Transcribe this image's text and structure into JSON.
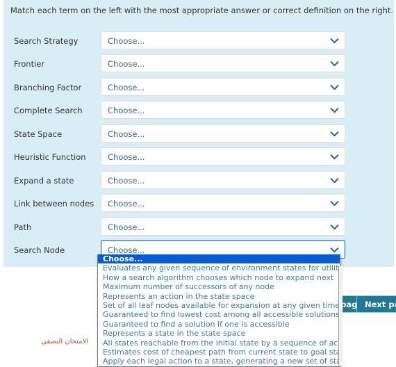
{
  "question": {
    "prompt": "Match each term on the left with the most appropriate answer or correct definition on the right.",
    "rows": [
      {
        "term": "Search Strategy",
        "value": "Choose..."
      },
      {
        "term": "Frontier",
        "value": "Choose..."
      },
      {
        "term": "Branching Factor",
        "value": "Choose..."
      },
      {
        "term": "Complete Search",
        "value": "Choose..."
      },
      {
        "term": "State Space",
        "value": "Choose..."
      },
      {
        "term": "Heuristic Function",
        "value": "Choose..."
      },
      {
        "term": "Expand a state",
        "value": "Choose..."
      },
      {
        "term": "Link between nodes",
        "value": "Choose..."
      },
      {
        "term": "Path",
        "value": "Choose..."
      },
      {
        "term": "Search Node",
        "value": "Choose..."
      }
    ]
  },
  "dropdown": {
    "open_for_row": "Search Node",
    "options": [
      "Choose...",
      "Evaluates any given sequence of environment states for utility",
      "How a search algorithm chooses which node to expand next",
      "Maximum number of successors of any node",
      "Represents an action in the state space",
      "Set of all leaf nodes available for expansion at any given time",
      "Guaranteed to find lowest cost among all accessible solutions",
      "Guaranteed to find a solution if one is accessible",
      "Represents a state in the state space",
      "All states reachable from the initial state by a sequence of actions",
      "Estimates cost of cheapest path from current state to goal state",
      "Apply each legal action to a state, generating a new set of states"
    ],
    "selected_index": 0
  },
  "navigation": {
    "previous_label": "Previous page",
    "next_label": "Next page"
  },
  "footer": {
    "note": "الامتحان النصفي"
  },
  "colors": {
    "panel_background": "#d9edf7",
    "select_text": "#3a6a86",
    "option_text": "#3a7f9e",
    "highlight": "#0a5bd3",
    "button": "#21788f",
    "footer_text": "#c2552a"
  }
}
